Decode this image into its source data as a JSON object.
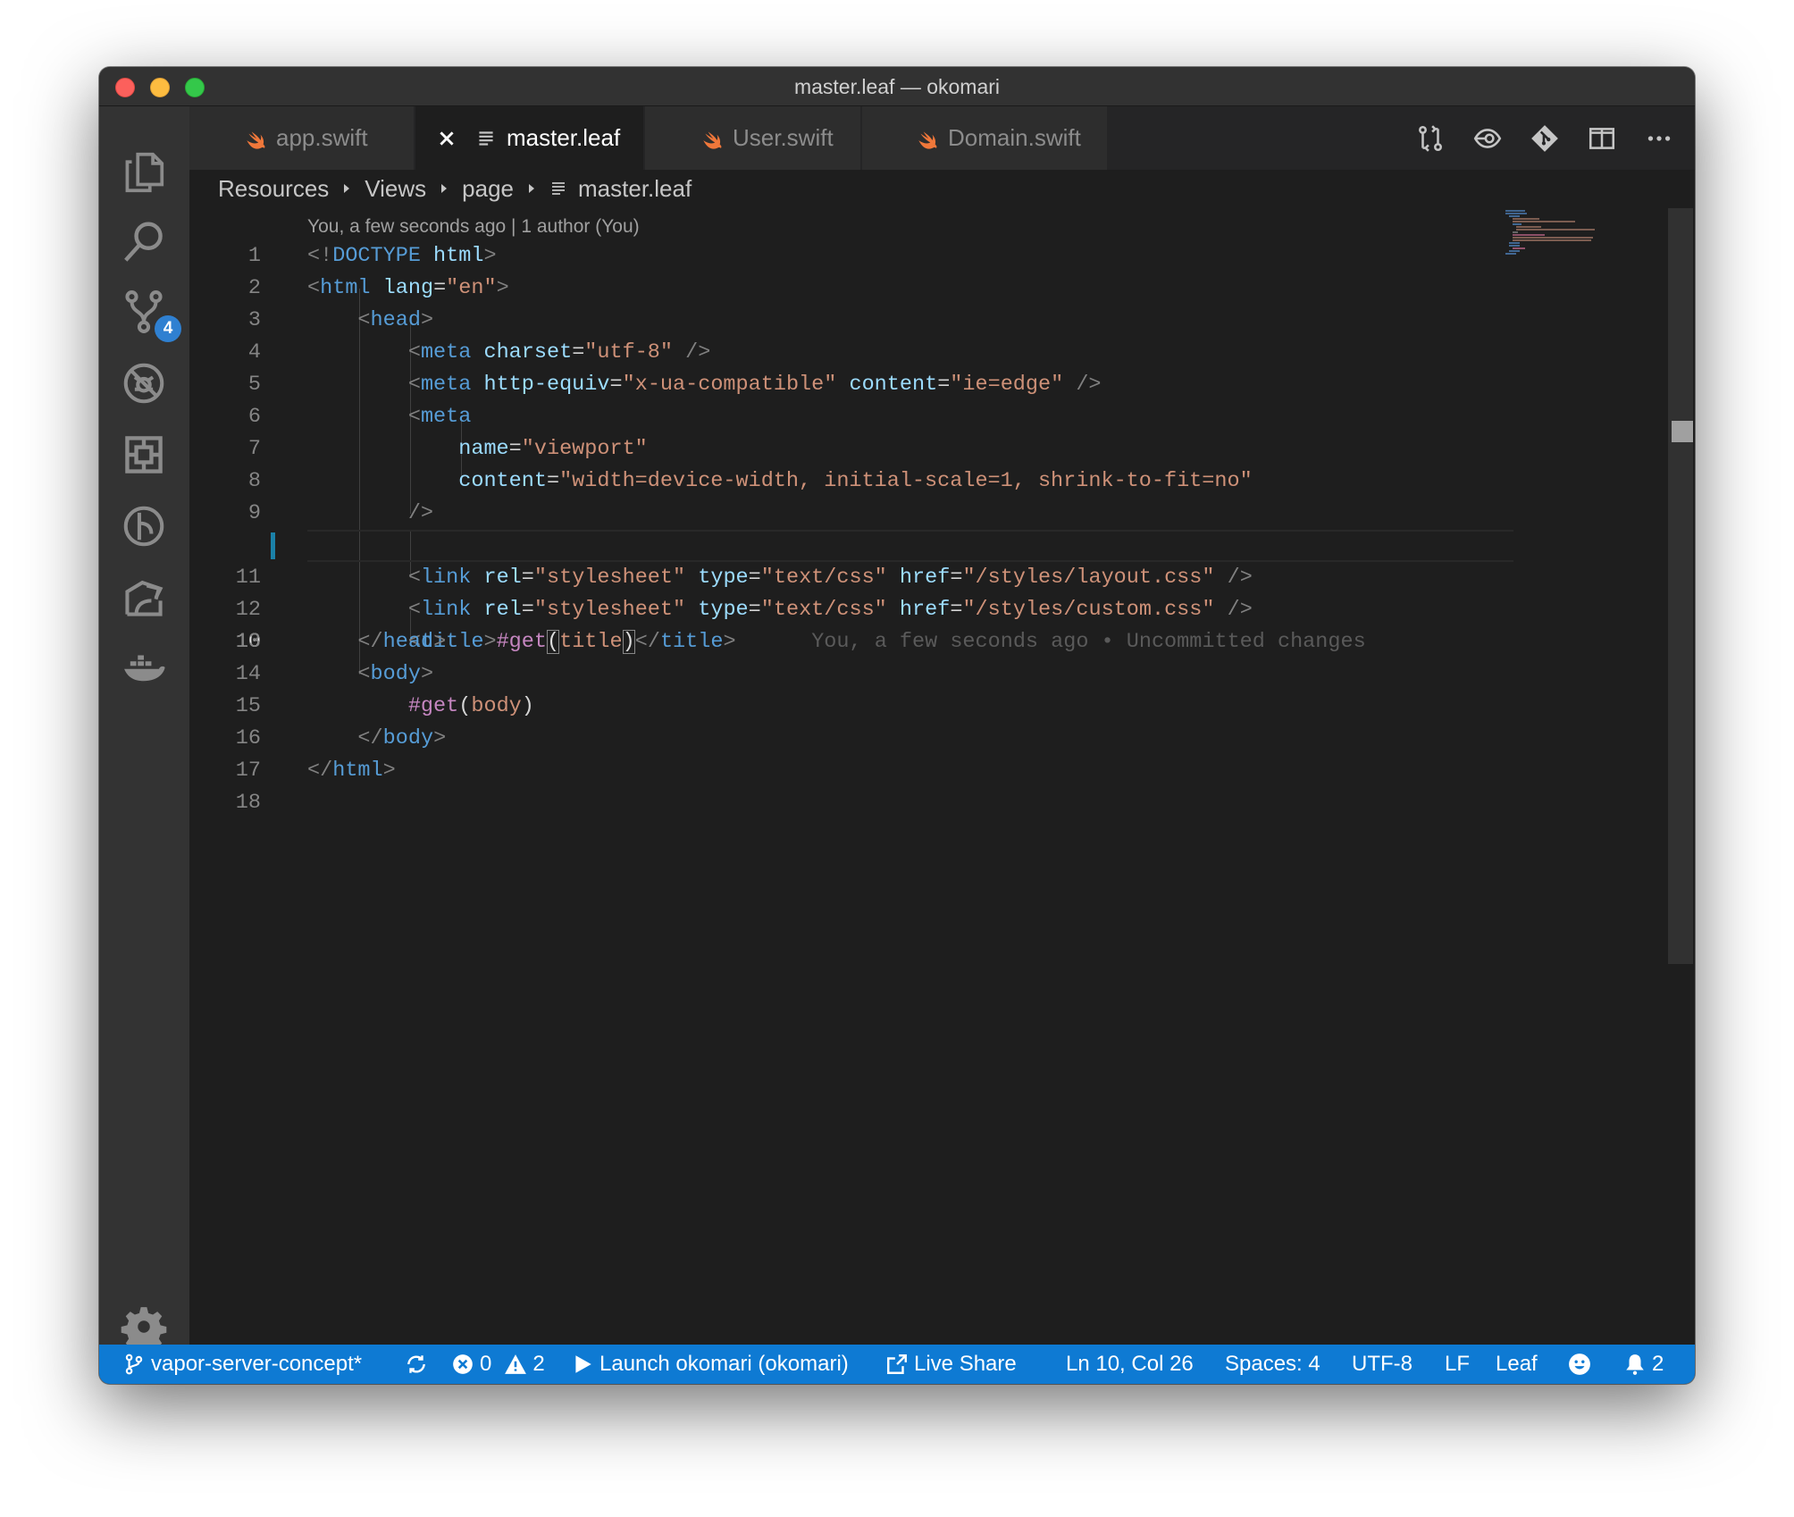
{
  "window": {
    "title": "master.leaf — okomari"
  },
  "activity_bar": {
    "scm_badge": "4"
  },
  "tabs": [
    {
      "label": "app.swift",
      "icon": "swift-icon"
    },
    {
      "label": "master.leaf",
      "icon": "lines-icon",
      "active": true
    },
    {
      "label": "User.swift",
      "icon": "swift-icon"
    },
    {
      "label": "Domain.swift",
      "icon": "swift-icon"
    }
  ],
  "breadcrumb": [
    "Resources",
    "Views",
    "page",
    "master.leaf"
  ],
  "codelens": "You, a few seconds ago | 1 author (You)",
  "editor": {
    "current_line": 10,
    "blame": "You, a few seconds ago • Uncommitted changes",
    "line_numbers": [
      "1",
      "2",
      "3",
      "4",
      "5",
      "6",
      "7",
      "8",
      "9",
      "10",
      "11",
      "12",
      "13",
      "14",
      "15",
      "16",
      "17",
      "18"
    ],
    "lines": [
      "<!DOCTYPE html>",
      "<html lang=\"en\">",
      "    <head>",
      "        <meta charset=\"utf-8\" />",
      "        <meta http-equiv=\"x-ua-compatible\" content=\"ie=edge\" />",
      "        <meta",
      "            name=\"viewport\"",
      "            content=\"width=device-width, initial-scale=1, shrink-to-fit=no\"",
      "        />",
      "        <title>#get(title)</title>",
      "        <link rel=\"stylesheet\" type=\"text/css\" href=\"/styles/layout.css\" />",
      "        <link rel=\"stylesheet\" type=\"text/css\" href=\"/styles/custom.css\" />",
      "    </head>",
      "    <body>",
      "        #get(body)",
      "    </body>",
      "</html>",
      ""
    ]
  },
  "status": {
    "branch": "vapor-server-concept*",
    "errors": "0",
    "warnings": "2",
    "launch": "Launch okomari (okomari)",
    "live_share": "Live Share",
    "position": "Ln 10, Col 26",
    "spaces": "Spaces: 4",
    "encoding": "UTF-8",
    "eol": "LF",
    "language": "Leaf",
    "notifications": "2"
  },
  "colors": {
    "statusbar": "#0e7ad3",
    "editor_bg": "#1e1e1e",
    "tag": "#569cd6",
    "attr": "#9cdcfe",
    "string": "#ce9178",
    "swift": "#f0773a"
  }
}
